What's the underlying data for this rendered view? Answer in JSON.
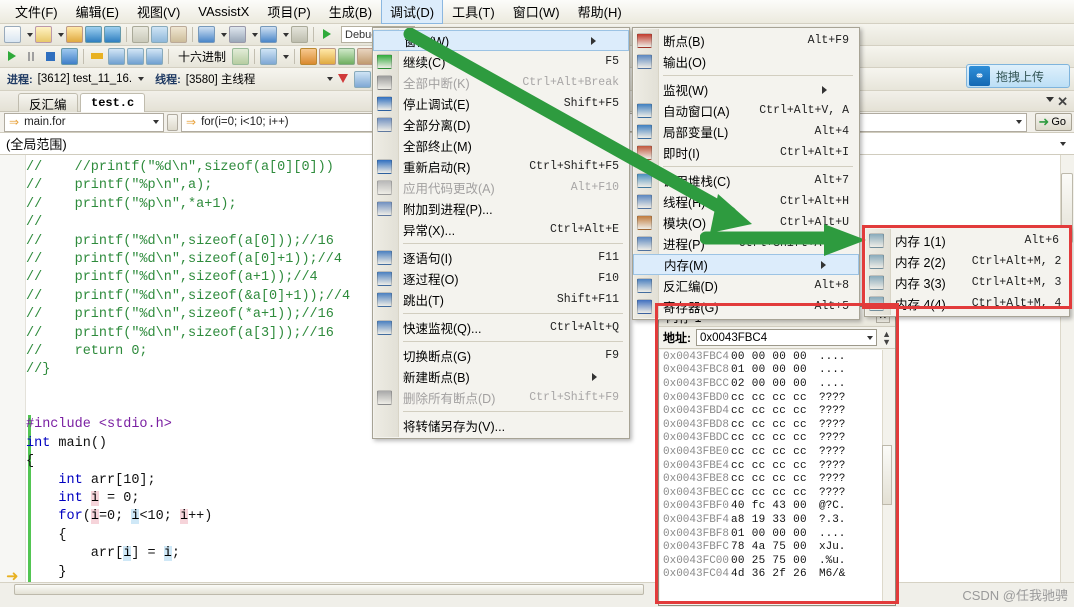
{
  "menubar": {
    "items": [
      {
        "label": "文件(F)",
        "active": false
      },
      {
        "label": "编辑(E)",
        "active": false
      },
      {
        "label": "视图(V)",
        "active": false
      },
      {
        "label": "VAssistX",
        "active": false
      },
      {
        "label": "项目(P)",
        "active": false
      },
      {
        "label": "生成(B)",
        "active": false
      },
      {
        "label": "调试(D)",
        "active": true
      },
      {
        "label": "工具(T)",
        "active": false
      },
      {
        "label": "窗口(W)",
        "active": false
      },
      {
        "label": "帮助(H)",
        "active": false
      }
    ]
  },
  "toolbar1": {
    "config_value": "Debug"
  },
  "toolbar2": {
    "hex_label": "十六进制"
  },
  "toolbar3": {
    "process_label": "进程:",
    "process_value": "[3612] test_11_16.",
    "thread_label": "线程:",
    "thread_value": "[3580] 主线程"
  },
  "upload": {
    "label": "拖拽上传",
    "icon": "link-icon"
  },
  "tabs": {
    "inactive": "反汇编",
    "active": "test.c",
    "close_label": "✕"
  },
  "navbar": {
    "scope_value": "main.for",
    "member_value": "for(i=0; i<10; i++)",
    "go_label": "Go"
  },
  "scopebar": {
    "text": "(全局范围)"
  },
  "code": {
    "lines": [
      {
        "indent": 0,
        "spans": [
          {
            "t": "//    //printf(\"%d\\n\",sizeof(a[0][0]))",
            "c": "cmt"
          }
        ]
      },
      {
        "indent": 0,
        "spans": [
          {
            "t": "//    printf(\"%p\\n\",a);",
            "c": "cmt"
          }
        ]
      },
      {
        "indent": 0,
        "spans": [
          {
            "t": "//    printf(\"%p\\n\",*a+1);",
            "c": "cmt"
          }
        ]
      },
      {
        "indent": 0,
        "spans": [
          {
            "t": "//",
            "c": "cmt"
          }
        ]
      },
      {
        "indent": 0,
        "spans": [
          {
            "t": "//    printf(\"%d\\n\",sizeof(a[0]));//16",
            "c": "cmt"
          }
        ]
      },
      {
        "indent": 0,
        "spans": [
          {
            "t": "//    printf(\"%d\\n\",sizeof(a[0]+1));//4",
            "c": "cmt"
          }
        ]
      },
      {
        "indent": 0,
        "spans": [
          {
            "t": "//    printf(\"%d\\n\",sizeof(a+1));//4",
            "c": "cmt"
          }
        ]
      },
      {
        "indent": 0,
        "spans": [
          {
            "t": "//    printf(\"%d\\n\",sizeof(&a[0]+1));//4",
            "c": "cmt"
          }
        ]
      },
      {
        "indent": 0,
        "spans": [
          {
            "t": "//    printf(\"%d\\n\",sizeof(*a+1));//16",
            "c": "cmt"
          }
        ]
      },
      {
        "indent": 0,
        "spans": [
          {
            "t": "//    printf(\"%d\\n\",sizeof(a[3]));//16",
            "c": "cmt"
          }
        ]
      },
      {
        "indent": 0,
        "spans": [
          {
            "t": "//    return 0;",
            "c": "cmt"
          }
        ]
      },
      {
        "indent": 0,
        "spans": [
          {
            "t": "//}",
            "c": "cmt"
          }
        ]
      },
      {
        "indent": 0,
        "spans": [
          {
            "t": "",
            "c": "plain"
          }
        ]
      },
      {
        "indent": 0,
        "spans": [
          {
            "t": "",
            "c": "plain"
          }
        ]
      },
      {
        "indent": 0,
        "spans": [
          {
            "t": "#include <stdio.h>",
            "c": "pp"
          }
        ]
      },
      {
        "indent": 0,
        "spans": [
          {
            "t": "int",
            "c": "kw"
          },
          {
            "t": " main()",
            "c": "plain"
          }
        ]
      },
      {
        "indent": 0,
        "spans": [
          {
            "t": "{",
            "c": "plain"
          }
        ]
      },
      {
        "indent": 0,
        "spans": [
          {
            "t": "    ",
            "c": "plain"
          },
          {
            "t": "int",
            "c": "kw"
          },
          {
            "t": " arr[10];",
            "c": "plain"
          }
        ]
      },
      {
        "indent": 0,
        "spans": [
          {
            "t": "    ",
            "c": "plain"
          },
          {
            "t": "int",
            "c": "kw"
          },
          {
            "t": " ",
            "c": "plain"
          },
          {
            "t": "i",
            "c": "hl-pink"
          },
          {
            "t": " = 0;",
            "c": "plain"
          }
        ]
      },
      {
        "indent": 0,
        "spans": [
          {
            "t": "    ",
            "c": "plain"
          },
          {
            "t": "for",
            "c": "kw"
          },
          {
            "t": "(",
            "c": "plain"
          },
          {
            "t": "i",
            "c": "hl-pink"
          },
          {
            "t": "=0; ",
            "c": "plain"
          },
          {
            "t": "i",
            "c": "hl-blue"
          },
          {
            "t": "<10; ",
            "c": "plain"
          },
          {
            "t": "i",
            "c": "hl-pink"
          },
          {
            "t": "++)",
            "c": "plain"
          }
        ]
      },
      {
        "indent": 0,
        "spans": [
          {
            "t": "    {",
            "c": "plain"
          }
        ]
      },
      {
        "indent": 0,
        "spans": [
          {
            "t": "        arr[",
            "c": "plain"
          },
          {
            "t": "i",
            "c": "hl-blue"
          },
          {
            "t": "] = ",
            "c": "plain"
          },
          {
            "t": "i",
            "c": "hl-blue"
          },
          {
            "t": ";",
            "c": "plain"
          }
        ]
      },
      {
        "indent": 0,
        "spans": [
          {
            "t": "    }",
            "c": "plain"
          }
        ]
      }
    ]
  },
  "debug_menu": {
    "items": [
      {
        "label": "窗口(W)",
        "key": "",
        "submenu": true,
        "disabled": false,
        "highlight": true,
        "icon": null
      },
      {
        "label": "继续(C)",
        "key": "F5",
        "submenu": false,
        "disabled": false,
        "icon": "play-icon",
        "iconcolor": "#2faa3a"
      },
      {
        "label": "全部中断(K)",
        "key": "Ctrl+Alt+Break",
        "submenu": false,
        "disabled": true,
        "icon": "pause-icon",
        "iconcolor": "#9a9a9a"
      },
      {
        "label": "停止调试(E)",
        "key": "Shift+F5",
        "submenu": false,
        "disabled": false,
        "icon": "stop-icon",
        "iconcolor": "#2f6fbf"
      },
      {
        "label": "全部分离(D)",
        "key": "",
        "submenu": false,
        "disabled": false,
        "icon": "detach-icon",
        "iconcolor": "#6f8fc0"
      },
      {
        "label": "全部终止(M)",
        "key": "",
        "submenu": false,
        "disabled": false,
        "icon": null
      },
      {
        "label": "重新启动(R)",
        "key": "Ctrl+Shift+F5",
        "submenu": false,
        "disabled": false,
        "icon": "restart-icon",
        "iconcolor": "#2f6fbf"
      },
      {
        "label": "应用代码更改(A)",
        "key": "Alt+F10",
        "submenu": false,
        "disabled": true,
        "icon": "apply-icon",
        "iconcolor": "#b8b8b8"
      },
      {
        "label": "附加到进程(P)...",
        "key": "",
        "submenu": false,
        "disabled": false,
        "icon": "attach-icon",
        "iconcolor": "#6f8fc0"
      },
      {
        "label": "异常(X)...",
        "key": "Ctrl+Alt+E",
        "submenu": false,
        "disabled": false,
        "icon": null
      },
      {
        "sep": true
      },
      {
        "label": "逐语句(I)",
        "key": "F11",
        "submenu": false,
        "disabled": false,
        "icon": "stepinto-icon",
        "iconcolor": "#4a7fbf"
      },
      {
        "label": "逐过程(O)",
        "key": "F10",
        "submenu": false,
        "disabled": false,
        "icon": "stepover-icon",
        "iconcolor": "#4a7fbf"
      },
      {
        "label": "跳出(T)",
        "key": "Shift+F11",
        "submenu": false,
        "disabled": false,
        "icon": "stepout-icon",
        "iconcolor": "#4a7fbf"
      },
      {
        "sep": true
      },
      {
        "label": "快速监视(Q)...",
        "key": "Ctrl+Alt+Q",
        "submenu": false,
        "disabled": false,
        "icon": "watch-icon",
        "iconcolor": "#4a7fbf"
      },
      {
        "sep": true
      },
      {
        "label": "切换断点(G)",
        "key": "F9",
        "submenu": false,
        "disabled": false,
        "icon": null
      },
      {
        "label": "新建断点(B)",
        "key": "",
        "submenu": true,
        "disabled": false,
        "icon": null
      },
      {
        "label": "删除所有断点(D)",
        "key": "Ctrl+Shift+F9",
        "submenu": false,
        "disabled": true,
        "icon": "delbp-icon",
        "iconcolor": "#a8a8a8"
      },
      {
        "sep": true
      },
      {
        "label": "将转储另存为(V)...",
        "key": "",
        "submenu": false,
        "disabled": false,
        "icon": null
      }
    ]
  },
  "window_submenu": {
    "items": [
      {
        "label": "断点(B)",
        "key": "Alt+F9",
        "submenu": false,
        "disabled": false,
        "icon": "breakpoint-icon",
        "iconcolor": "#c0392b"
      },
      {
        "label": "输出(O)",
        "key": "",
        "submenu": false,
        "disabled": false,
        "icon": "output-icon",
        "iconcolor": "#5a86bf"
      },
      {
        "sep": true
      },
      {
        "label": "监视(W)",
        "key": "",
        "submenu": true,
        "disabled": false,
        "icon": null
      },
      {
        "label": "自动窗口(A)",
        "key": "Ctrl+Alt+V, A",
        "submenu": false,
        "disabled": false,
        "icon": "auto-icon",
        "iconcolor": "#3f7fbf"
      },
      {
        "label": "局部变量(L)",
        "key": "Alt+4",
        "submenu": false,
        "disabled": false,
        "icon": "locals-icon",
        "iconcolor": "#3f7fbf"
      },
      {
        "label": "即时(I)",
        "key": "Ctrl+Alt+I",
        "submenu": false,
        "disabled": false,
        "icon": "immediate-icon",
        "iconcolor": "#c0563b"
      },
      {
        "sep": true
      },
      {
        "label": "调用堆栈(C)",
        "key": "Alt+7",
        "submenu": false,
        "disabled": false,
        "icon": "callstack-icon",
        "iconcolor": "#4a8fbf"
      },
      {
        "label": "线程(H)",
        "key": "Ctrl+Alt+H",
        "submenu": false,
        "disabled": false,
        "icon": "threads-icon",
        "iconcolor": "#5a86bf"
      },
      {
        "label": "模块(O)",
        "key": "Ctrl+Alt+U",
        "submenu": false,
        "disabled": false,
        "icon": "modules-icon",
        "iconcolor": "#bf7a3b"
      },
      {
        "label": "进程(P)",
        "key": "Ctrl+Shift+Alt+P",
        "submenu": false,
        "disabled": false,
        "icon": "process-icon",
        "iconcolor": "#5a86bf"
      },
      {
        "label": "内存(M)",
        "key": "",
        "submenu": true,
        "disabled": false,
        "highlight": true,
        "icon": null
      },
      {
        "label": "反汇编(D)",
        "key": "Alt+8",
        "submenu": false,
        "disabled": false,
        "icon": "disasm-icon",
        "iconcolor": "#4a7fbf"
      },
      {
        "label": "寄存器(G)",
        "key": "Alt+5",
        "submenu": false,
        "disabled": false,
        "icon": "registers-icon",
        "iconcolor": "#3f6fbf"
      }
    ]
  },
  "memory_submenu": {
    "items": [
      {
        "label": "内存 1(1)",
        "key": "Alt+6",
        "icon": "memory-icon"
      },
      {
        "label": "内存 2(2)",
        "key": "Ctrl+Alt+M, 2",
        "icon": "memory-icon"
      },
      {
        "label": "内存 3(3)",
        "key": "Ctrl+Alt+M, 3",
        "icon": "memory-icon"
      },
      {
        "label": "内存 4(4)",
        "key": "Ctrl+Alt+M, 4",
        "icon": "memory-icon"
      }
    ]
  },
  "memory_window": {
    "title": "内存 1",
    "close_label": "✕",
    "address_label": "地址:",
    "address_value": "0x0043FBC4",
    "rows": [
      {
        "addr": "0x0043FBC4",
        "hex": "00 00 00 00",
        "text": "...."
      },
      {
        "addr": "0x0043FBC8",
        "hex": "01 00 00 00",
        "text": "...."
      },
      {
        "addr": "0x0043FBCC",
        "hex": "02 00 00 00",
        "text": "...."
      },
      {
        "addr": "0x0043FBD0",
        "hex": "cc cc cc cc",
        "text": "????"
      },
      {
        "addr": "0x0043FBD4",
        "hex": "cc cc cc cc",
        "text": "????"
      },
      {
        "addr": "0x0043FBD8",
        "hex": "cc cc cc cc",
        "text": "????"
      },
      {
        "addr": "0x0043FBDC",
        "hex": "cc cc cc cc",
        "text": "????"
      },
      {
        "addr": "0x0043FBE0",
        "hex": "cc cc cc cc",
        "text": "????"
      },
      {
        "addr": "0x0043FBE4",
        "hex": "cc cc cc cc",
        "text": "????"
      },
      {
        "addr": "0x0043FBE8",
        "hex": "cc cc cc cc",
        "text": "????"
      },
      {
        "addr": "0x0043FBEC",
        "hex": "cc cc cc cc",
        "text": "????"
      },
      {
        "addr": "0x0043FBF0",
        "hex": "40 fc 43 00",
        "text": "@?C."
      },
      {
        "addr": "0x0043FBF4",
        "hex": "a8 19 33 00",
        "text": "?.3."
      },
      {
        "addr": "0x0043FBF8",
        "hex": "01 00 00 00",
        "text": "...."
      },
      {
        "addr": "0x0043FBFC",
        "hex": "78 4a 75 00",
        "text": "xJu."
      },
      {
        "addr": "0x0043FC00",
        "hex": "00 25 75 00",
        "text": ".%u."
      },
      {
        "addr": "0x0043FC04",
        "hex": "4d 36 2f 26",
        "text": "M6/&"
      }
    ]
  },
  "watermark": {
    "text": "CSDN @任我驰骋"
  },
  "colors": {
    "accent_green": "#2e9b3f",
    "annotation_red": "#e23b3b",
    "highlight_blue": "#dcecfb",
    "comment_green": "#2e8b3c",
    "keyword_blue": "#0000c0"
  }
}
